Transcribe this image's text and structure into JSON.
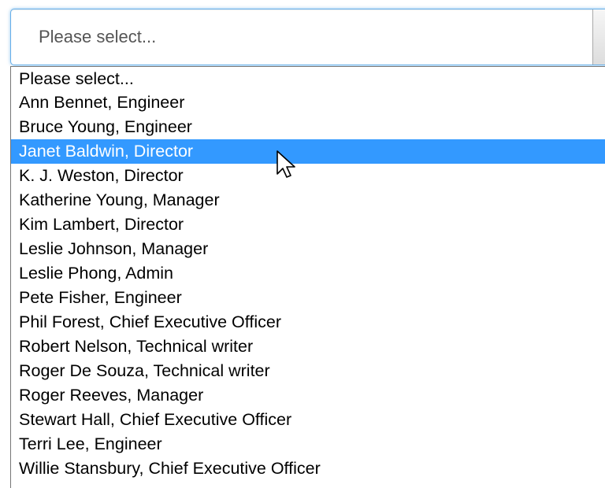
{
  "select": {
    "value": "Please select...",
    "options": [
      "Please select...",
      "Ann Bennet, Engineer",
      "Bruce Young, Engineer",
      "Janet Baldwin, Director",
      "K. J. Weston, Director",
      "Katherine Young, Manager",
      "Kim Lambert, Director",
      "Leslie Johnson, Manager",
      "Leslie Phong, Admin",
      "Pete Fisher, Engineer",
      "Phil Forest, Chief Executive Officer",
      "Robert Nelson, Technical writer",
      "Roger De Souza, Technical writer",
      "Roger Reeves, Manager",
      "Stewart Hall, Chief Executive Officer",
      "Terri Lee, Engineer",
      "Willie Stansbury, Chief Executive Officer"
    ],
    "highlighted_index": 3,
    "icons": {
      "dropdown_arrow": "chevron-down-icon",
      "cursor": "mouse-pointer-icon"
    }
  },
  "colors": {
    "highlight": "#3399ff",
    "focus_border": "#66afe9"
  }
}
